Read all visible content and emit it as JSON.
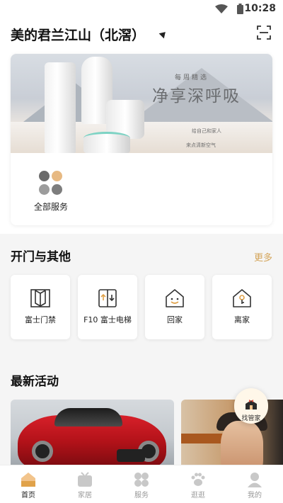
{
  "status": {
    "time": "10:28"
  },
  "header": {
    "community": "美的君兰江山（北滘）"
  },
  "banner": {
    "tag": "每周精选",
    "slogan": "净享深呼吸",
    "line1": "给自己和家人",
    "line2": "来点清新空气"
  },
  "quick": {
    "all_services": "全部服务"
  },
  "section_access": {
    "title": "开门与其他",
    "more": "更多"
  },
  "tiles": [
    {
      "label": "富士门禁",
      "icon": "door-icon"
    },
    {
      "label": "F10 富士电梯",
      "icon": "elevator-icon"
    },
    {
      "label": "回家",
      "icon": "home-smile-icon"
    },
    {
      "label": "离家",
      "icon": "home-leave-icon"
    }
  ],
  "section_activity": {
    "title": "最新活动"
  },
  "floating": {
    "label": "找管家"
  },
  "tabs": [
    {
      "label": "首页",
      "active": true,
      "icon": "home-icon"
    },
    {
      "label": "家居",
      "active": false,
      "icon": "tv-icon"
    },
    {
      "label": "服务",
      "active": false,
      "icon": "grid-icon"
    },
    {
      "label": "逛逛",
      "active": false,
      "icon": "paw-icon"
    },
    {
      "label": "我的",
      "active": false,
      "icon": "user-icon"
    }
  ],
  "colors": {
    "accent": "#d4a55b",
    "background": "#f5f5f5"
  }
}
